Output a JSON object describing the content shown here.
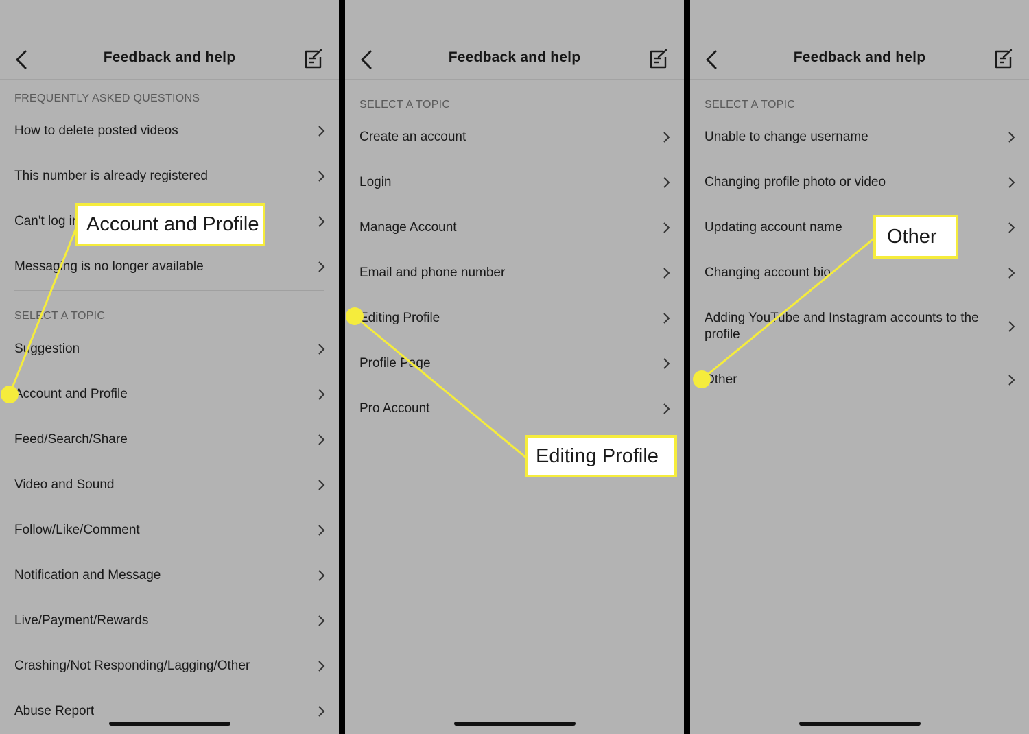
{
  "panels": [
    {
      "title": "Feedback and help",
      "faq_label": "FREQUENTLY ASKED QUESTIONS",
      "faq_items": [
        "How to delete posted videos",
        "This number is already registered",
        "Can't log in",
        "Messaging is no longer available"
      ],
      "topic_label": "SELECT A TOPIC",
      "topic_items": [
        "Suggestion",
        "Account and Profile",
        "Feed/Search/Share",
        "Video and Sound",
        "Follow/Like/Comment",
        "Notification and Message",
        "Live/Payment/Rewards",
        "Crashing/Not Responding/Lagging/Other",
        "Abuse Report"
      ],
      "callout": "Account and Profile"
    },
    {
      "title": "Feedback and help",
      "topic_label": "SELECT A TOPIC",
      "topic_items": [
        "Create an account",
        "Login",
        "Manage Account",
        "Email and phone number",
        "Editing Profile",
        "Profile Page",
        "Pro Account"
      ],
      "callout": "Editing Profile"
    },
    {
      "title": "Feedback and help",
      "topic_label": "SELECT A TOPIC",
      "topic_items": [
        "Unable to change username",
        "Changing profile photo or video",
        "Updating account name",
        "Changing account bio",
        "Adding YouTube and Instagram accounts to the profile",
        "Other"
      ],
      "callout": "Other"
    }
  ],
  "colors": {
    "panel_bg": "#b3b3b3",
    "highlight": "#f5ec3c",
    "text": "#1a1a1a",
    "section_text": "#5a5a5a"
  },
  "icons": {
    "back": "chevron-left-icon",
    "edit": "compose-icon",
    "row": "chevron-right-icon"
  }
}
